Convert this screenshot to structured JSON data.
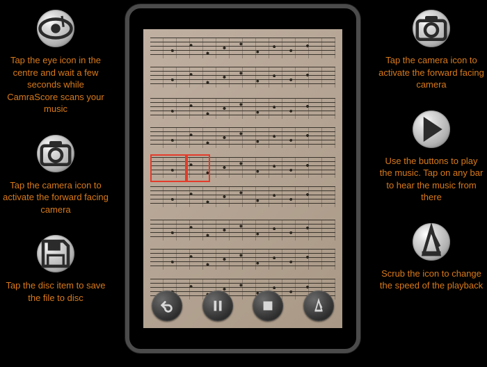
{
  "left": {
    "items": [
      {
        "icon": "eye-note",
        "text": "Tap the eye icon in the centre and wait a few seconds while CamraScore scans your music"
      },
      {
        "icon": "camera",
        "text": "Tap the camera icon to activate the forward facing camera"
      },
      {
        "icon": "save",
        "text": "Tap the disc item to save the file to disc"
      }
    ]
  },
  "right": {
    "items": [
      {
        "icon": "camera",
        "text": "Tap the camera icon to activate the forward facing camera"
      },
      {
        "icon": "play",
        "text": "Use the buttons to play the music. Tap on any bar to hear the music from there"
      },
      {
        "icon": "metronome",
        "text": "Scrub the icon to change the speed of the playback"
      }
    ]
  },
  "device": {
    "controls": [
      {
        "name": "back-button",
        "icon": "undo"
      },
      {
        "name": "pause-button",
        "icon": "pause"
      },
      {
        "name": "stop-button",
        "icon": "stop"
      },
      {
        "name": "metronome-button",
        "icon": "metronome"
      }
    ],
    "selection": {
      "bars_highlighted": 2
    }
  },
  "colors": {
    "accent": "#d97a1a",
    "highlight": "#e43b2a"
  }
}
